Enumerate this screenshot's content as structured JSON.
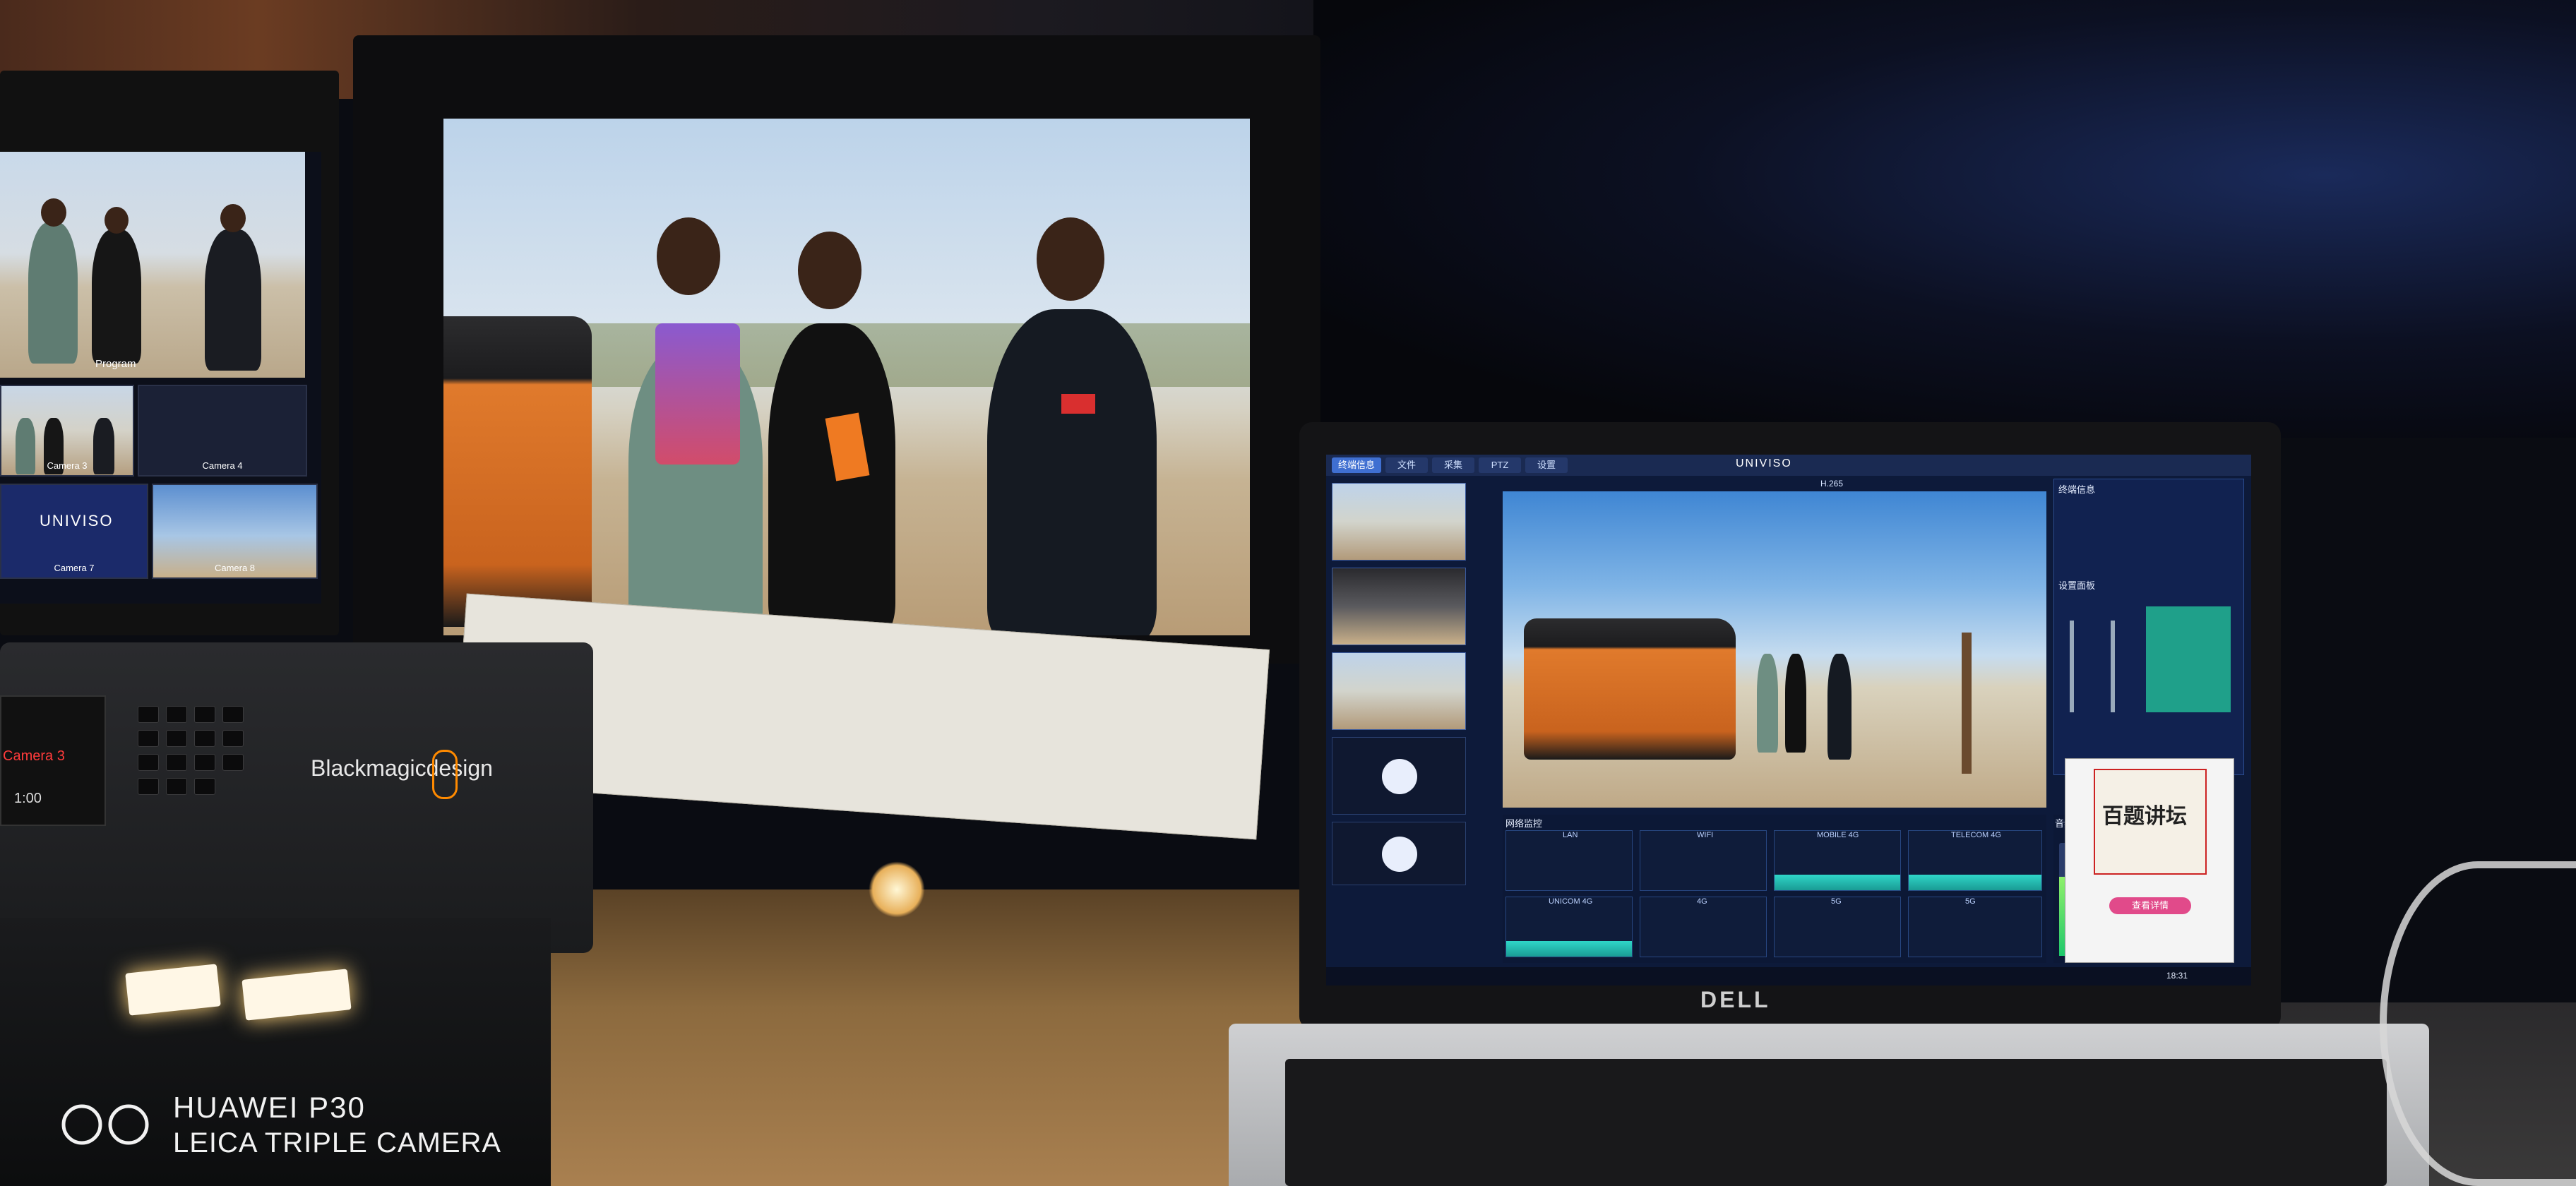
{
  "watermark": {
    "line1": "HUAWEI P30",
    "line2": "LEICA TRIPLE CAMERA"
  },
  "multiview": {
    "program_label": "Program",
    "cam3_label": "Camera 3",
    "cam4_label": "Camera 4",
    "cam7_label": "Camera 7",
    "cam8_label": "Camera 8",
    "logo": "UNIVISO"
  },
  "switcher": {
    "brand": "Blackmagicdesign",
    "lcd_label": "Camera 3",
    "lcd_time": "1:00"
  },
  "laptop": {
    "brand": "DELL",
    "app_logo": "UNIVISO",
    "tabs": [
      "终端信息",
      "文件",
      "采集",
      "PTZ",
      "设置"
    ],
    "active_tab": 0,
    "info_title": "终端信息",
    "settings_title": "设置面板",
    "network_title": "网络监控",
    "audio_title": "音频",
    "codec": "H.265",
    "network_cells": [
      "LAN",
      "WIFI",
      "MOBILE 4G",
      "TELECOM 4G",
      "UNICOM 4G",
      "4G",
      "5G",
      "5G"
    ],
    "popup_title": "百题讲坛",
    "popup_button": "查看详情",
    "time": "18:31"
  },
  "colors": {
    "app_bg": "#0d1a3a",
    "accent": "#3f6fd1",
    "wave": "#2fd6c8",
    "car_orange": "#e07a2c"
  }
}
